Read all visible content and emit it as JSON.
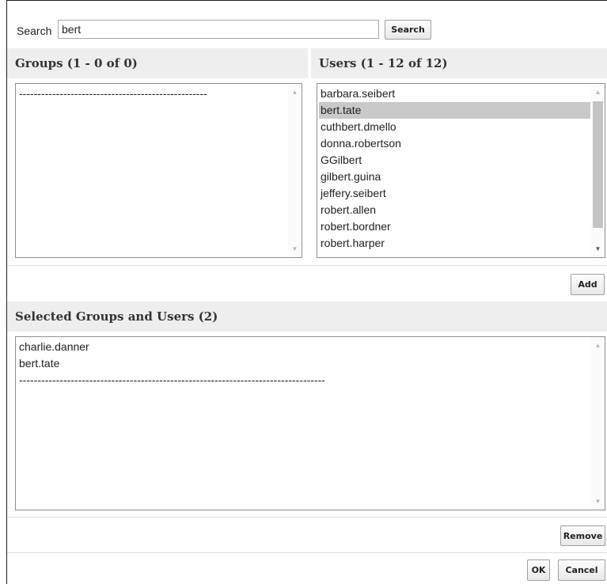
{
  "search": {
    "label": "Search",
    "value": "bert",
    "button_label": "Search"
  },
  "groups": {
    "header": "Groups (1 - 0 of 0)",
    "items": [
      "---------------------------------------------------"
    ]
  },
  "users": {
    "header": "Users (1 - 12 of 12)",
    "items": [
      "barbara.seibert",
      "bert.tate",
      "cuthbert.dmello",
      "donna.robertson",
      "GGilbert",
      "gilbert.guina",
      "jeffery.seibert",
      "robert.allen",
      "robert.bordner",
      "robert.harper"
    ],
    "selected": "bert.tate"
  },
  "add_button": "Add",
  "selected_section": {
    "header": "Selected Groups and Users (2)",
    "items": [
      "charlie.danner",
      "bert.tate",
      "-----------------------------------------------------------------------------------"
    ]
  },
  "remove_button": "Remove",
  "ok_button": "OK",
  "cancel_button": "Cancel",
  "icons": {
    "scroll_up": "scroll-up-arrow-icon",
    "scroll_down": "scroll-down-arrow-icon"
  }
}
